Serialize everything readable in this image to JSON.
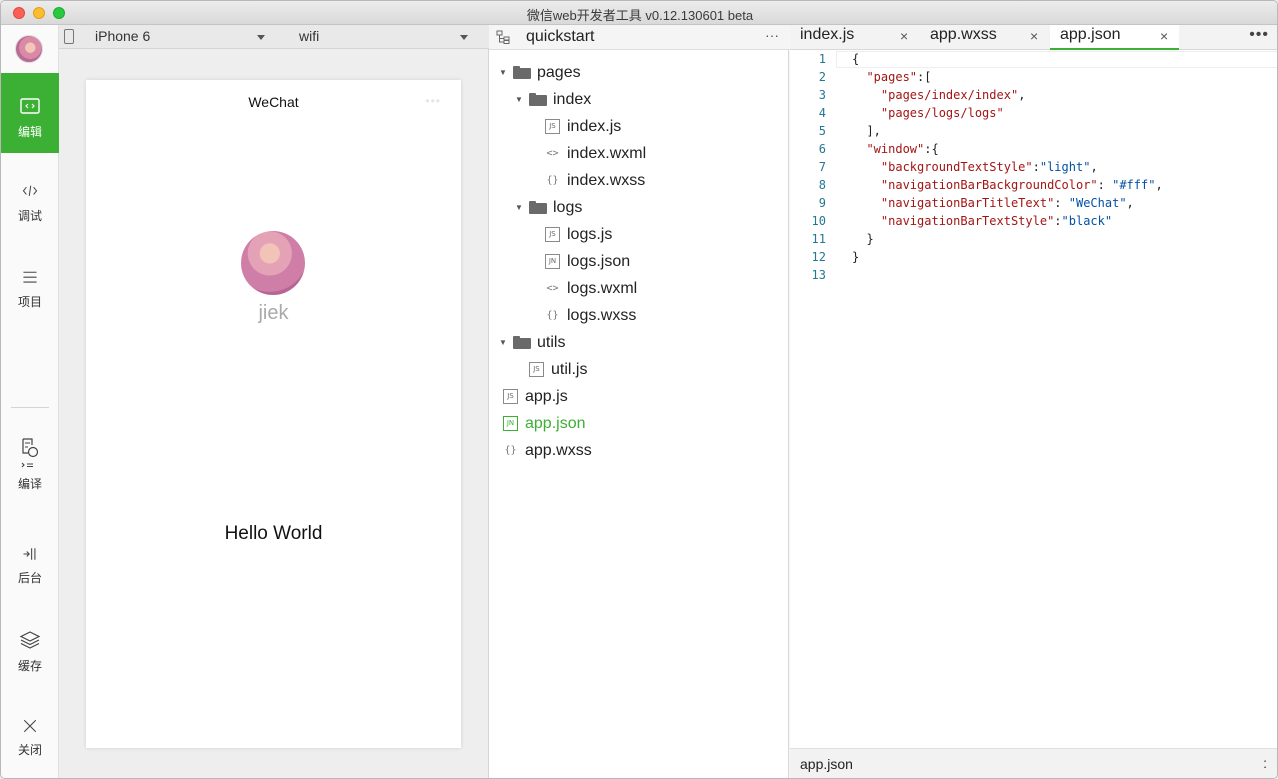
{
  "window": {
    "title": "微信web开发者工具 v0.12.130601 beta"
  },
  "sidebar": {
    "items": [
      {
        "label": "编辑",
        "icon": "code-icon",
        "active": true
      },
      {
        "label": "调试",
        "icon": "debug-icon",
        "active": false
      },
      {
        "label": "项目",
        "icon": "menu-icon",
        "active": false
      },
      {
        "label": "编译",
        "icon": "compile-icon",
        "active": false
      },
      {
        "label": "后台",
        "icon": "backend-icon",
        "active": false
      },
      {
        "label": "缓存",
        "icon": "layers-icon",
        "active": false
      },
      {
        "label": "关闭",
        "icon": "close-icon",
        "active": false
      }
    ]
  },
  "simulator": {
    "device": "iPhone 6",
    "network": "wifi",
    "nav_title": "WeChat",
    "nav_dots": "•••",
    "user_name": "jiek",
    "hello_text": "Hello World"
  },
  "tree": {
    "project": "quickstart",
    "more": "···",
    "rows": [
      {
        "label": "pages",
        "type": "folder",
        "depth": 0,
        "expanded": true
      },
      {
        "label": "index",
        "type": "folder",
        "depth": 1,
        "expanded": true
      },
      {
        "label": "index.js",
        "type": "js",
        "depth": 2
      },
      {
        "label": "index.wxml",
        "type": "wxml",
        "depth": 2
      },
      {
        "label": "index.wxss",
        "type": "wxss",
        "depth": 2
      },
      {
        "label": "logs",
        "type": "folder",
        "depth": 1,
        "expanded": true
      },
      {
        "label": "logs.js",
        "type": "js",
        "depth": 2
      },
      {
        "label": "logs.json",
        "type": "json",
        "depth": 2
      },
      {
        "label": "logs.wxml",
        "type": "wxml",
        "depth": 2
      },
      {
        "label": "logs.wxss",
        "type": "wxss",
        "depth": 2
      },
      {
        "label": "utils",
        "type": "folder",
        "depth": 0,
        "expanded": true
      },
      {
        "label": "util.js",
        "type": "js",
        "depth": 1
      },
      {
        "label": "app.js",
        "type": "js",
        "depth": 0
      },
      {
        "label": "app.json",
        "type": "json",
        "depth": 0,
        "active": true
      },
      {
        "label": "app.wxss",
        "type": "wxss",
        "depth": 0
      }
    ],
    "file_badges": {
      "js": "JS",
      "json": "JN",
      "wxml": "<>",
      "wxss": "{}"
    }
  },
  "editor": {
    "tabs": [
      {
        "label": "index.js",
        "active": false
      },
      {
        "label": "app.wxss",
        "active": false
      },
      {
        "label": "app.json",
        "active": true
      }
    ],
    "tab_close": "×",
    "more": "•••",
    "lines": [
      "{",
      "  \"pages\":[",
      "    \"pages/index/index\",",
      "    \"pages/logs/logs\"",
      "  ],",
      "  \"window\":{",
      "    \"backgroundTextStyle\":\"light\",",
      "    \"navigationBarBackgroundColor\": \"#fff\",",
      "    \"navigationBarTitleText\": \"WeChat\",",
      "    \"navigationBarTextStyle\":\"black\"",
      "  }",
      "}",
      ""
    ],
    "status_file": "app.json",
    "status_right": ":"
  },
  "colors": {
    "accent": "#3cb034",
    "json_key": "#a31515",
    "json_value": "#0451a5",
    "line_number": "#237893"
  }
}
